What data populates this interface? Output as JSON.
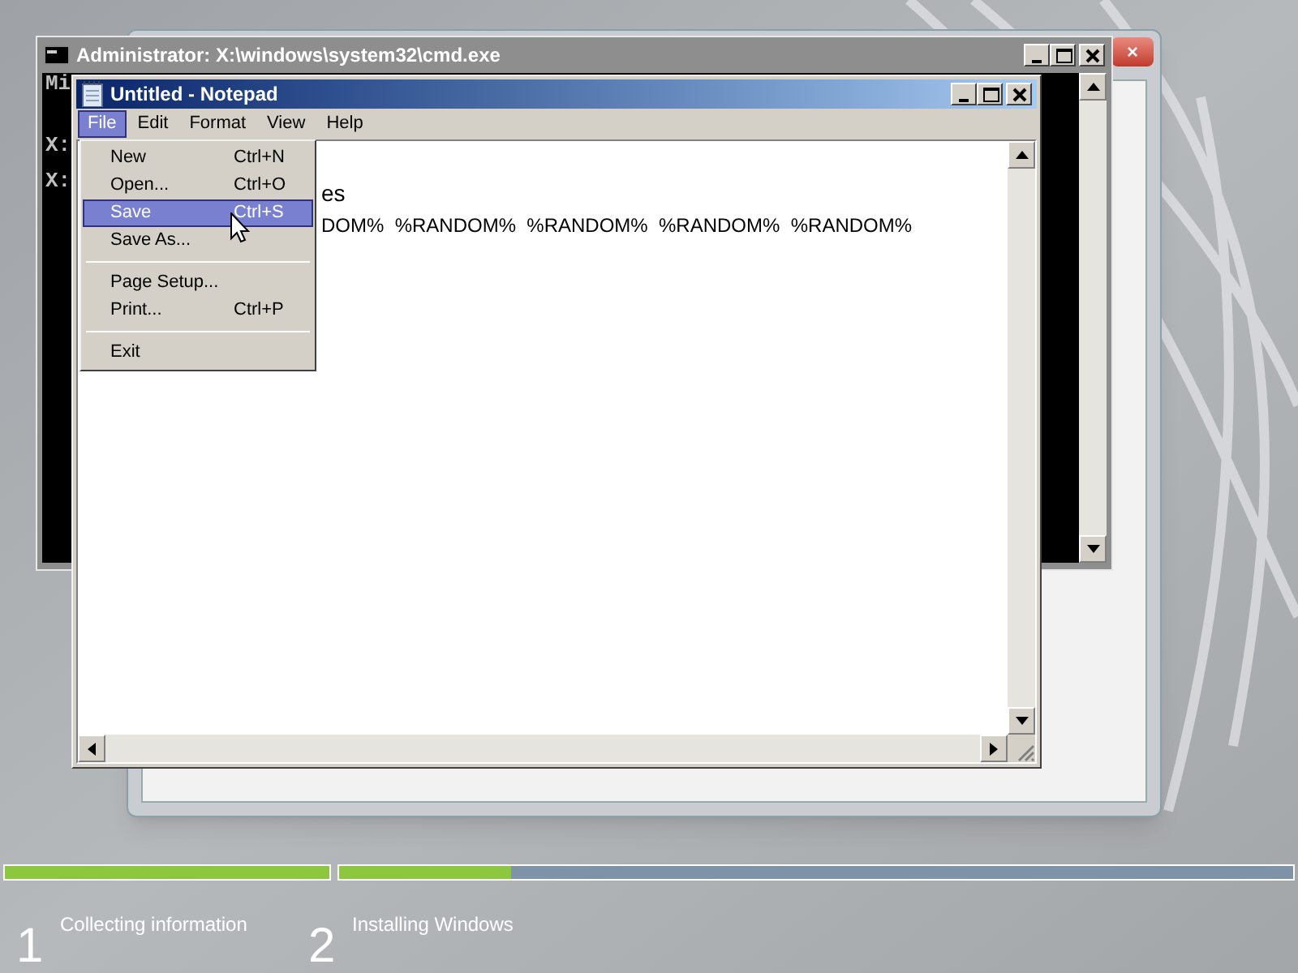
{
  "setup_window": {
    "close_label": "×"
  },
  "cmd_window": {
    "title": "Administrator: X:\\windows\\system32\\cmd.exe",
    "lines": [
      "Mi",
      "X:",
      "X:"
    ]
  },
  "notepad": {
    "title": "Untitled - Notepad",
    "menu": [
      {
        "label": "File",
        "selected": true
      },
      {
        "label": "Edit",
        "selected": false
      },
      {
        "label": "Format",
        "selected": false
      },
      {
        "label": "View",
        "selected": false
      },
      {
        "label": "Help",
        "selected": false
      }
    ],
    "text_lines": [
      "es",
      "DOM%  %RANDOM%  %RANDOM%  %RANDOM%  %RANDOM%"
    ]
  },
  "file_menu": {
    "items": [
      {
        "kind": "item",
        "label": "New",
        "shortcut": "Ctrl+N",
        "selected": false
      },
      {
        "kind": "item",
        "label": "Open...",
        "shortcut": "Ctrl+O",
        "selected": false
      },
      {
        "kind": "item",
        "label": "Save",
        "shortcut": "Ctrl+S",
        "selected": true
      },
      {
        "kind": "item",
        "label": "Save As...",
        "selected": false
      },
      {
        "kind": "separator"
      },
      {
        "kind": "item",
        "label": "Page Setup...",
        "selected": false
      },
      {
        "kind": "item",
        "label": "Print...",
        "shortcut": "Ctrl+P",
        "selected": false
      },
      {
        "kind": "separator"
      },
      {
        "kind": "item",
        "label": "Exit",
        "selected": false
      }
    ]
  },
  "progress": {
    "steps": [
      {
        "number": "1",
        "label": "Collecting information",
        "level": 1
      },
      {
        "number": "2",
        "label": "Installing Windows",
        "level": 0.18
      }
    ]
  }
}
